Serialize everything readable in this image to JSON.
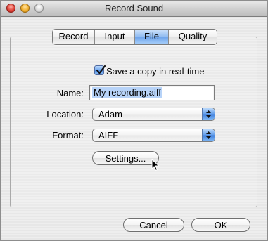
{
  "window": {
    "title": "Record Sound"
  },
  "tabs": [
    {
      "label": "Record",
      "selected": false
    },
    {
      "label": "Input",
      "selected": false
    },
    {
      "label": "File",
      "selected": true
    },
    {
      "label": "Quality",
      "selected": false
    }
  ],
  "file_panel": {
    "save_copy": {
      "label": "Save a copy in real-time",
      "checked": true
    },
    "name": {
      "label": "Name:",
      "value": "My recording.aiff"
    },
    "location": {
      "label": "Location:",
      "value": "Adam"
    },
    "format": {
      "label": "Format:",
      "value": "AIFF"
    },
    "settings_button": "Settings..."
  },
  "footer": {
    "cancel_label": "Cancel",
    "ok_label": "OK"
  },
  "colors": {
    "selection": "#b7d3f8",
    "accent_blue": "#6ca2ea"
  },
  "icons": [
    "close-icon",
    "minimize-icon",
    "zoom-icon",
    "checkmark-icon",
    "popup-arrows-icon",
    "mouse-pointer-icon"
  ]
}
